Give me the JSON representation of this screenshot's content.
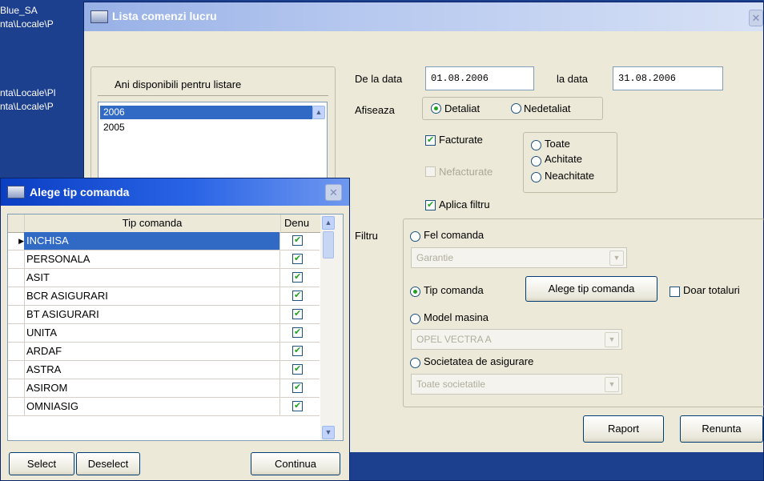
{
  "desktop": {
    "lines": [
      "Blue_SA",
      "nta\\Locale\\P",
      "nta\\Locale\\Pl",
      "nta\\Locale\\P"
    ]
  },
  "main_window": {
    "title": "Lista comenzi lucru",
    "years_label": "Ani disponibili pentru listare",
    "years": [
      "2006",
      "2005"
    ],
    "from_label": "De la data",
    "from_value": "01.08.2006",
    "to_label": "la data",
    "to_value": "31.08.2006",
    "display_label": "Afiseaza",
    "detailed": "Detaliat",
    "not_detailed": "Nedetaliat",
    "invoiced": "Facturate",
    "not_invoiced": "Nefacturate",
    "all": "Toate",
    "paid": "Achitate",
    "unpaid": "Neachitate",
    "apply_filter": "Aplica filtru",
    "filter_label": "Filtru",
    "order_kind": "Fel comanda",
    "order_kind_value": "Garantie",
    "order_type": "Tip comanda",
    "choose_order_type": "Alege tip comanda",
    "totals_only": "Doar totaluri",
    "car_model": "Model masina",
    "car_model_value": "OPEL VECTRA A",
    "insurer": "Societatea de asigurare",
    "insurer_value": "Toate societatile",
    "report_button": "Raport",
    "cancel_button": "Renunta"
  },
  "dialog": {
    "title": "Alege tip comanda",
    "col_type": "Tip comanda",
    "col_denu": "Denu",
    "rows": [
      {
        "name": "INCHISA",
        "checked": true,
        "selected": true
      },
      {
        "name": "PERSONALA",
        "checked": true
      },
      {
        "name": "ASIT",
        "checked": true
      },
      {
        "name": "BCR ASIGURARI",
        "checked": true
      },
      {
        "name": "BT ASIGURARI",
        "checked": true
      },
      {
        "name": "UNITA",
        "checked": true
      },
      {
        "name": "ARDAF",
        "checked": true
      },
      {
        "name": "ASTRA",
        "checked": true
      },
      {
        "name": "ASIROM",
        "checked": true
      },
      {
        "name": "OMNIASIG",
        "checked": true
      }
    ],
    "select_button": "Select",
    "deselect_button": "Deselect",
    "continue_button": "Continua"
  }
}
